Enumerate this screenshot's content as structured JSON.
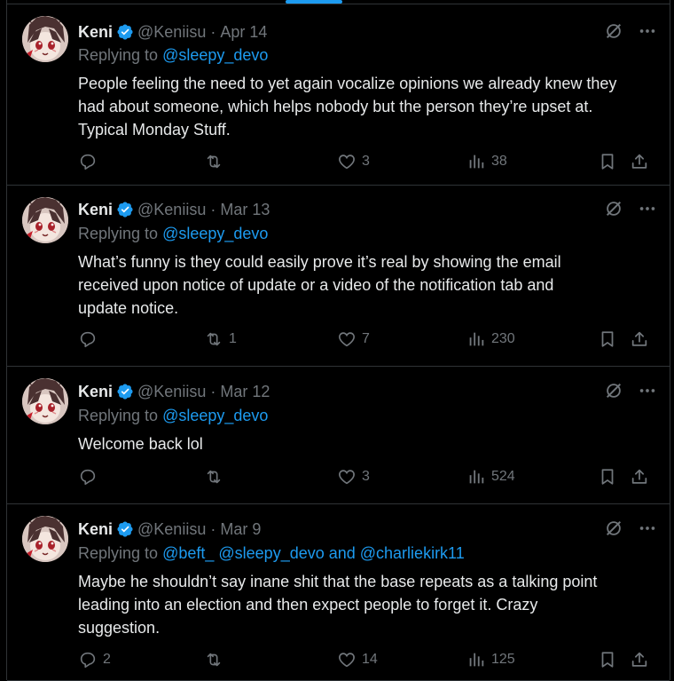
{
  "tweets": [
    {
      "name": "Keni",
      "handle": "@Keniisu",
      "sep": "·",
      "date": "Apr 14",
      "replying_prefix": "Replying to",
      "replying_to": "@sleepy_devo",
      "lines": [
        "People feeling the need to yet again vocalize opinions we already knew they",
        "had about someone, which helps nobody but the person they’re upset at.",
        "Typical Monday Stuff."
      ],
      "replies": "",
      "retweets": "",
      "likes": "3",
      "views": "38"
    },
    {
      "name": "Keni",
      "handle": "@Keniisu",
      "sep": "·",
      "date": "Mar 13",
      "replying_prefix": "Replying to",
      "replying_to": "@sleepy_devo",
      "lines": [
        "What’s funny is they could easily prove it’s real by showing the email",
        "received upon notice of update or a video of the notification tab and",
        "update notice."
      ],
      "replies": "",
      "retweets": "1",
      "likes": "7",
      "views": "230"
    },
    {
      "name": "Keni",
      "handle": "@Keniisu",
      "sep": "·",
      "date": "Mar 12",
      "replying_prefix": "Replying to",
      "replying_to": "@sleepy_devo",
      "lines": [
        "Welcome back lol"
      ],
      "replies": "",
      "retweets": "",
      "likes": "3",
      "views": "524"
    },
    {
      "name": "Keni",
      "handle": "@Keniisu",
      "sep": "·",
      "date": "Mar 9",
      "replying_prefix": "Replying to",
      "replying_to": "@beft_ @sleepy_devo and @charliekirk11",
      "lines": [
        "Maybe he shouldn’t say inane shit that the base repeats as a talking point",
        "leading into an election and then expect people to forget it. Crazy",
        "suggestion."
      ],
      "replies": "2",
      "retweets": "",
      "likes": "14",
      "views": "125"
    }
  ],
  "icons": {
    "verified": "verified-badge-icon",
    "grok": "grok-icon",
    "more": "more-icon",
    "reply": "reply-icon",
    "retweet": "retweet-icon",
    "like": "like-icon",
    "views": "views-icon",
    "bookmark": "bookmark-icon",
    "share": "share-icon"
  },
  "colors": {
    "background": "#000000",
    "text": "#e7e9ea",
    "muted": "#71767b",
    "accent": "#1d9bf0",
    "border": "#2f3336"
  }
}
